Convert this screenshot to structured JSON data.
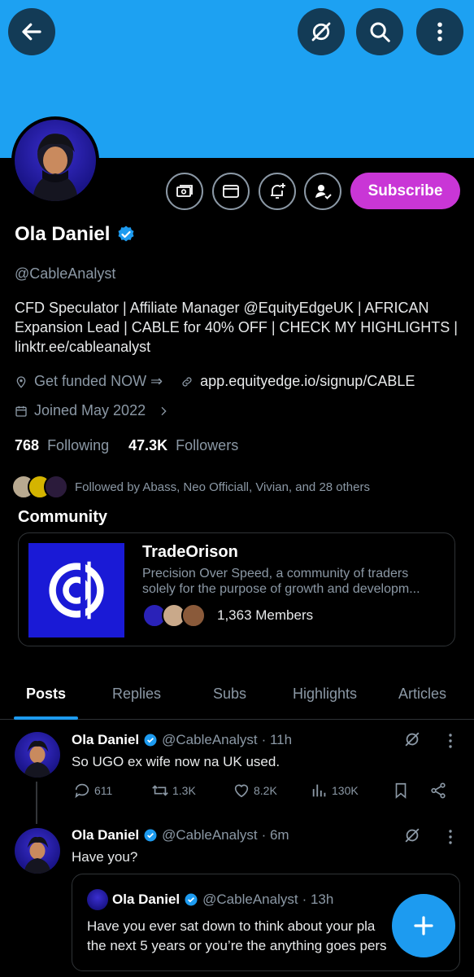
{
  "header": {
    "back_icon": "arrow-left-icon",
    "grok_icon": "grok-icon",
    "search_icon": "search-icon",
    "more_icon": "more-vertical-icon",
    "banner_color": "#1da1f2"
  },
  "profile": {
    "name": "Ola Daniel",
    "handle": "@CableAnalyst",
    "bio": "CFD Speculator | Affiliate Manager @EquityEdgeUK | AFRICAN Expansion Lead | CABLE for 40% OFF | CHECK MY HIGHLIGHTS | linktr.ee/cableanalyst",
    "location": "Get funded NOW ⇒",
    "website": "app.equityedge.io/signup/CABLE",
    "joined": "Joined May 2022",
    "following_count": "768",
    "following_label": "Following",
    "followers_count": "47.3K",
    "followers_label": "Followers",
    "followed_by": "Followed by Abass, Neo Officiall, Vivian, and 28 others",
    "subscribe_label": "Subscribe",
    "subscribe_color": "#c936d6",
    "accent_color": "#1d9bf0"
  },
  "community": {
    "section_title": "Community",
    "name": "TradeOrison",
    "description": "Precision Over Speed, a community of traders solely for the purpose of growth and developm...",
    "members": "1,363 Members"
  },
  "tabs": [
    {
      "label": "Posts"
    },
    {
      "label": "Replies"
    },
    {
      "label": "Subs"
    },
    {
      "label": "Highlights"
    },
    {
      "label": "Articles"
    }
  ],
  "posts": [
    {
      "name": "Ola Daniel",
      "handle": "@CableAnalyst",
      "time": "· 11h",
      "text": "So UGO ex wife now na UK used.",
      "replies": "611",
      "reposts": "1.3K",
      "likes": "8.2K",
      "views": "130K"
    },
    {
      "name": "Ola Daniel",
      "handle": "@CableAnalyst",
      "time": "· 6m",
      "text": "Have you?",
      "quote": {
        "name": "Ola Daniel",
        "handle": "@CableAnalyst",
        "time": "· 13h",
        "line1": "Have you ever sat down to think about your pla",
        "line2": "the next 5 years or you’re the anything goes pers"
      }
    }
  ],
  "fab_icon": "plus-icon"
}
